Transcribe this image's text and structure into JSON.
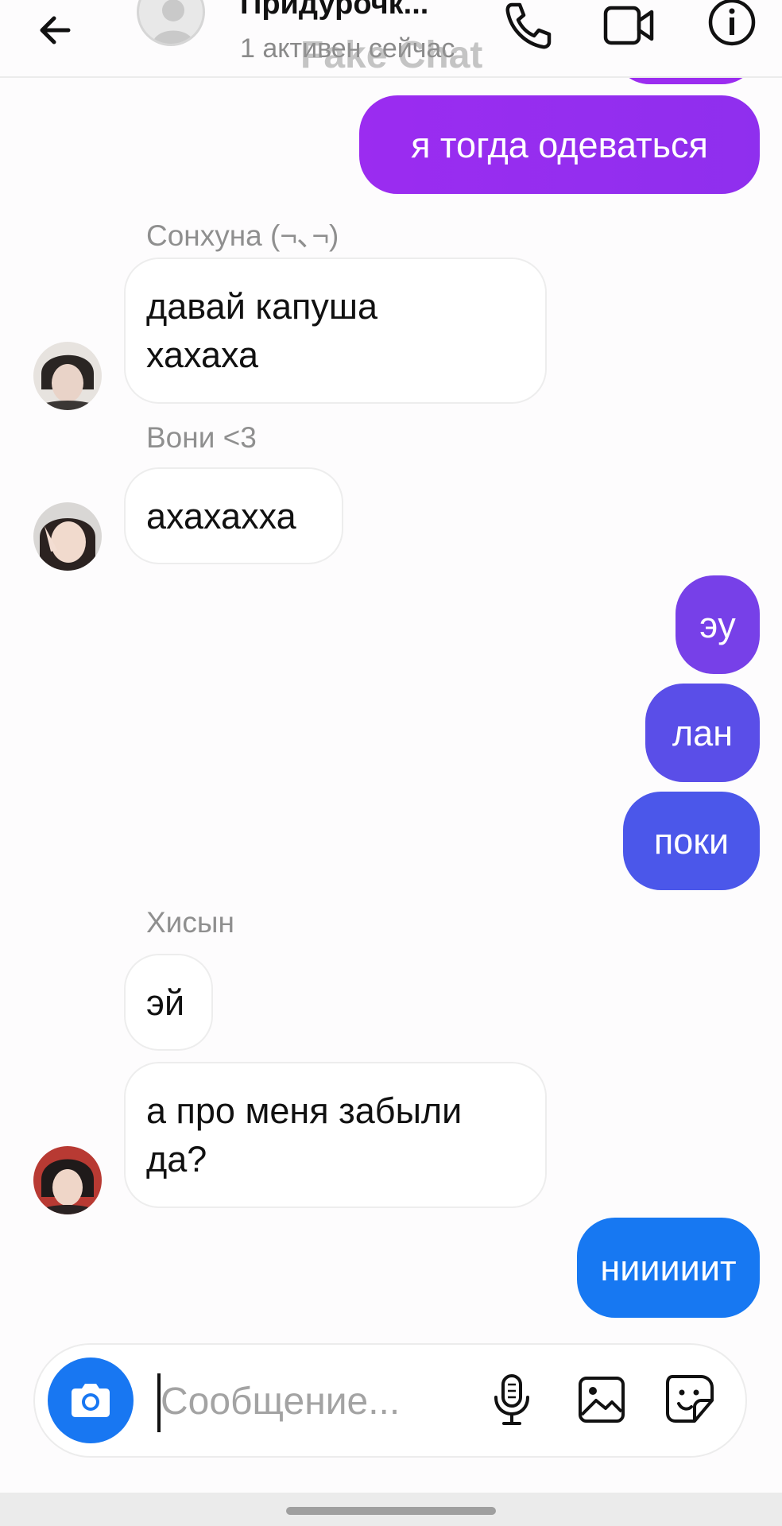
{
  "header": {
    "title": "Придурочк...",
    "subtitle": "1 активен сейчас",
    "watermark": "Fake Chat"
  },
  "messages": [
    {
      "id": "m0",
      "dir": "out",
      "text": "",
      "color": "#9b2cf0"
    },
    {
      "id": "m1",
      "dir": "out",
      "text": "я тогда одеваться",
      "color": "#9b2cf0"
    },
    {
      "id": "s1",
      "type": "sender",
      "text": "Сонхуна (¬､¬)"
    },
    {
      "id": "m2",
      "dir": "in",
      "lines": [
        "давай капуша",
        "хахаха"
      ],
      "avatar": "sunghoon"
    },
    {
      "id": "s2",
      "type": "sender",
      "text": "Вони <3"
    },
    {
      "id": "m3",
      "dir": "in",
      "lines": [
        "ахахахха"
      ],
      "avatar": "wonyoung"
    },
    {
      "id": "m4",
      "dir": "out",
      "text": "эу",
      "color": "#7740e8"
    },
    {
      "id": "m5",
      "dir": "out",
      "text": "лан",
      "color": "#5a4ee8"
    },
    {
      "id": "m6",
      "dir": "out",
      "text": "поки",
      "color": "#4b57ea"
    },
    {
      "id": "s3",
      "type": "sender",
      "text": "Хисын"
    },
    {
      "id": "m7",
      "dir": "in",
      "lines": [
        "эй"
      ]
    },
    {
      "id": "m8",
      "dir": "in",
      "lines": [
        "а про меня забыли",
        "да?"
      ],
      "avatar": "heeseung"
    },
    {
      "id": "m9",
      "dir": "out",
      "text": "нииииит",
      "color": "#1778f2"
    }
  ],
  "composer": {
    "placeholder": "Сообщение...",
    "camera_icon": "camera-icon",
    "mic_icon": "microphone-icon",
    "gallery_icon": "gallery-icon",
    "sticker_icon": "sticker-icon"
  },
  "colors": {
    "accent_blue": "#1877f2",
    "accent_purple": "#9b2cf0"
  }
}
